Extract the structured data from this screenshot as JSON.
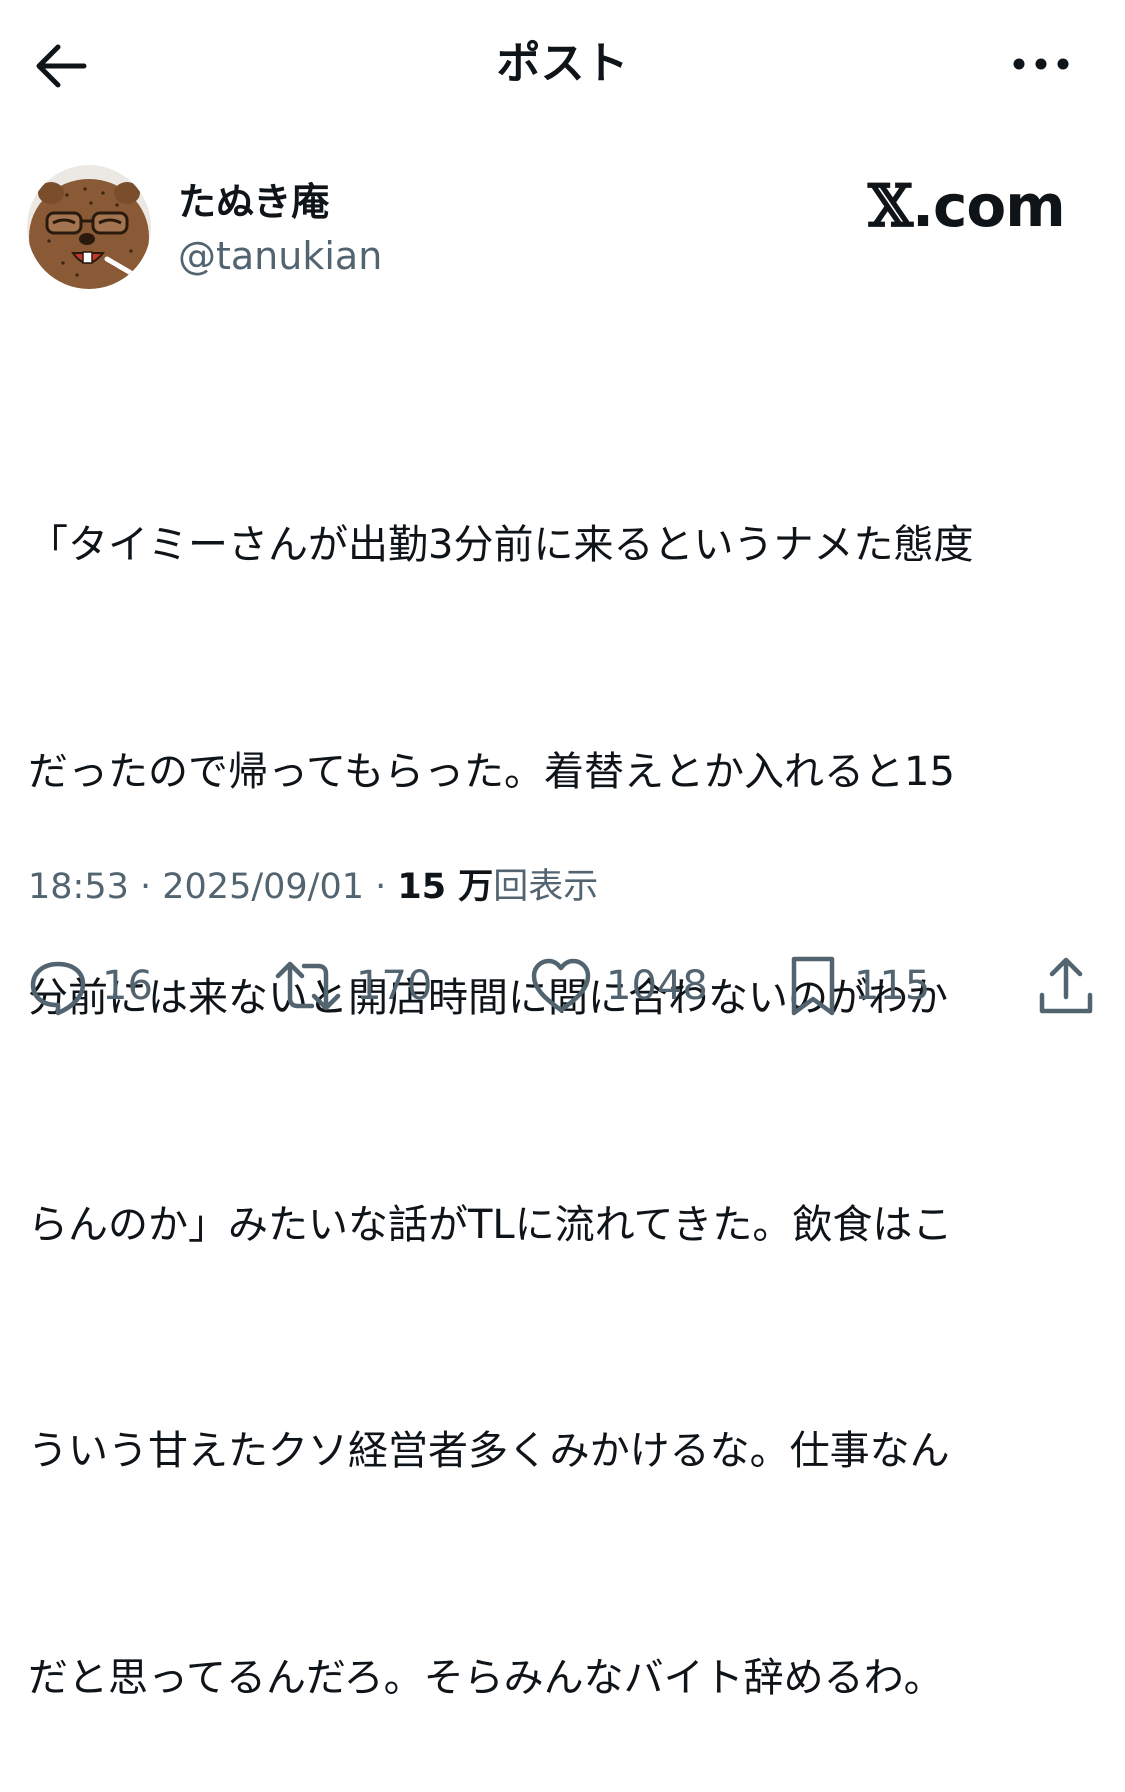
{
  "header": {
    "title": "ポスト",
    "back_icon": "arrow-left-icon",
    "more_icon": "more-horizontal-icon"
  },
  "author": {
    "display_name": "たぬき庵",
    "handle": "@tanukian",
    "avatar": "tanuki-avatar"
  },
  "watermark": {
    "glyph": "𝕏",
    "text": ".com"
  },
  "post": {
    "lines": [
      "「タイミーさんが出勤3分前に来るというナメた態度",
      "だったので帰ってもらった。着替えとか入れると15",
      "分前には来ないと開店時間に間に合わないのがわか",
      "らんのか」みたいな話がTLに流れてきた。飲食はこ",
      "ういう甘えたクソ経営者多くみかけるな。仕事なん",
      "だと思ってるんだろ。そらみんなバイト辞めるわ。"
    ]
  },
  "meta": {
    "time": "18:53",
    "sep1": " · ",
    "date": "2025/09/01",
    "sep2": " · ",
    "views_num": "15 万",
    "views_label": "回表示"
  },
  "actions": {
    "reply": {
      "icon": "reply-icon",
      "count": "16"
    },
    "repost": {
      "icon": "repost-icon",
      "count": "170"
    },
    "like": {
      "icon": "heart-icon",
      "count": "1048"
    },
    "bookmark": {
      "icon": "bookmark-icon",
      "count": "115"
    },
    "share": {
      "icon": "share-icon"
    }
  },
  "colors": {
    "text": "#0f1419",
    "secondary": "#536471",
    "background": "#ffffff"
  }
}
